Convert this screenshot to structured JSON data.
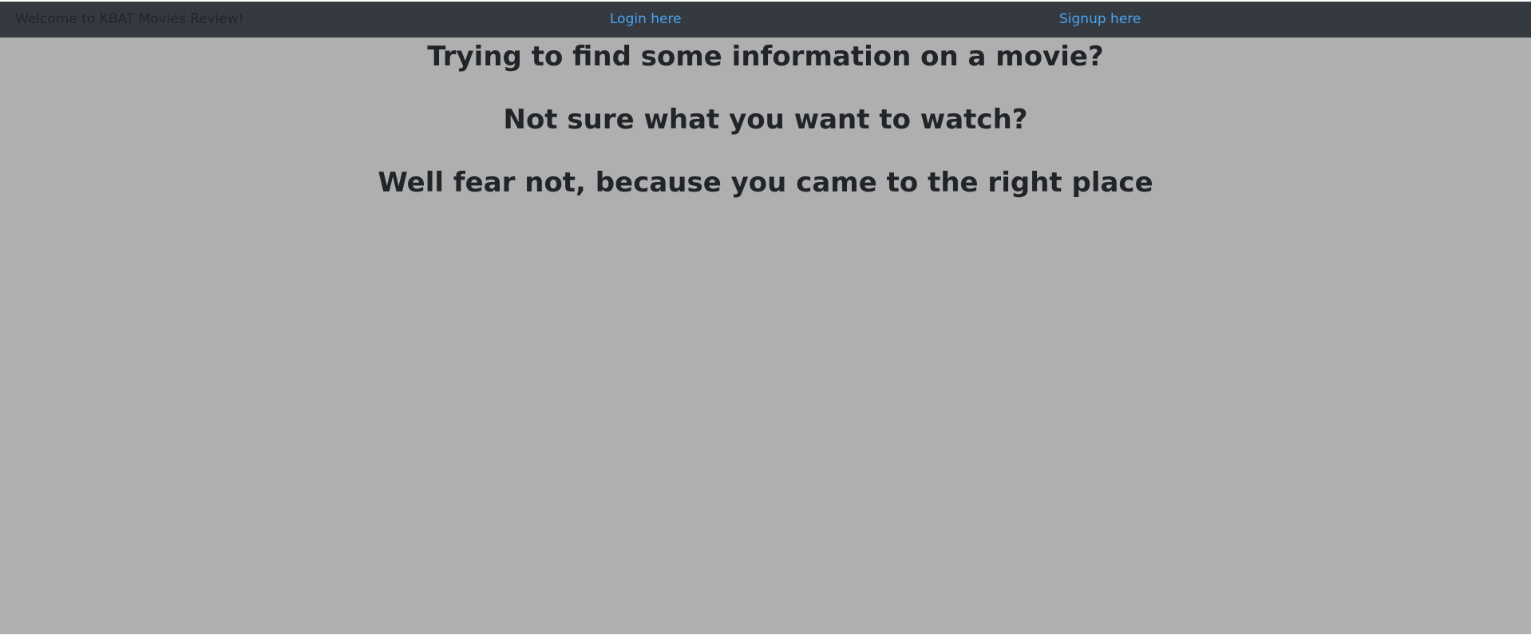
{
  "navbar": {
    "brand_text": "Welcome to KBAT Movies Review!",
    "login_label": "Login here",
    "signup_label": "Signup here"
  },
  "main": {
    "headlines": [
      "Trying to find some information on a movie?",
      "Not sure what you want to watch?",
      "Well fear not, because you came to the right place"
    ]
  },
  "colors": {
    "navbar_bg": "#343a40",
    "link": "#4aa3f0",
    "content_bg": "#afafaf",
    "text": "#212529"
  }
}
